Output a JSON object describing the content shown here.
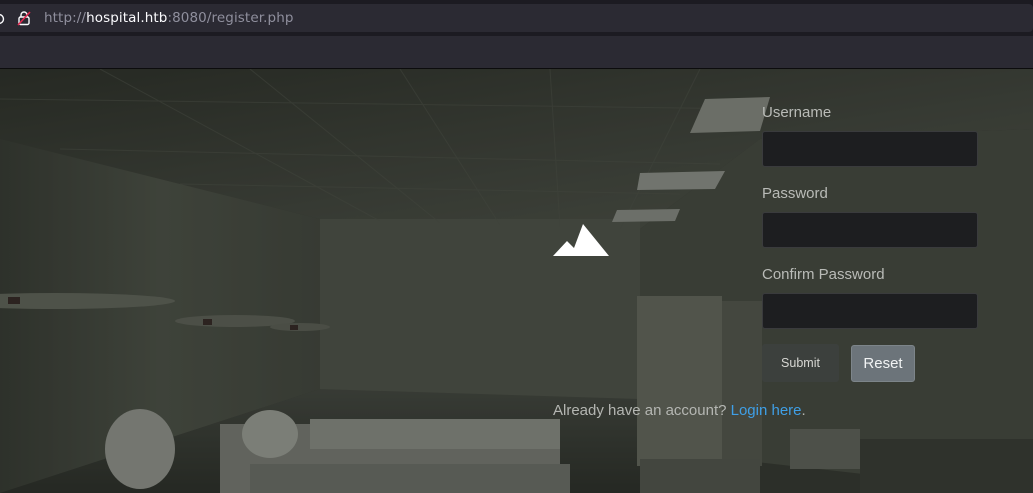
{
  "browser": {
    "url_scheme": "http://",
    "url_host": "hospital.htb",
    "url_rest": ":8080/register.php"
  },
  "form": {
    "username_label": "Username",
    "password_label": "Password",
    "confirm_label": "Confirm Password",
    "username_value": "",
    "password_value": "",
    "confirm_value": "",
    "submit_label": "Submit",
    "reset_label": "Reset"
  },
  "footer": {
    "prompt": "Already have an account?",
    "link_text": "Login here",
    "suffix": "."
  },
  "icons": {
    "url_left": "circle-slash-icon",
    "url_lock": "insecure-lock-icon",
    "logo": "mountain-logo-icon"
  },
  "colors": {
    "link": "#3f9fe6",
    "lock_warning": "#e22850",
    "reset_button": "#6c747a"
  }
}
